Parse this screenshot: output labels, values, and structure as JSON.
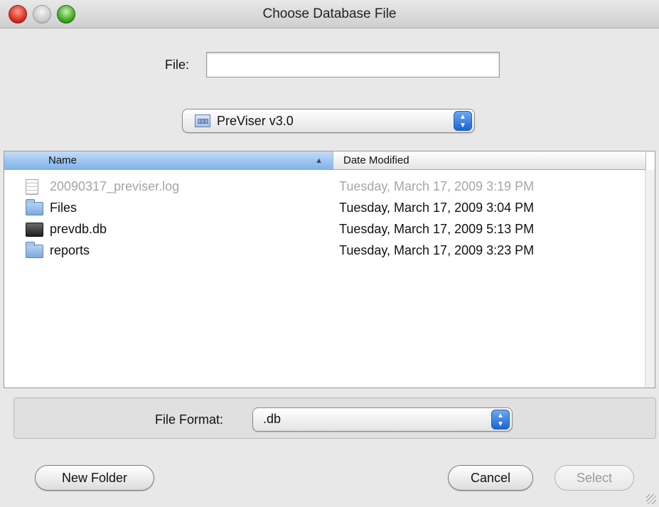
{
  "window": {
    "title": "Choose Database File"
  },
  "file": {
    "label": "File:",
    "value": "",
    "placeholder": ""
  },
  "location": {
    "selected": "PreViser v3.0",
    "icon": "folder-drive-icon"
  },
  "browser": {
    "columns": {
      "name": "Name",
      "date": "Date Modified",
      "sort": "ascending"
    },
    "rows": [
      {
        "name": "20090317_previser.log",
        "date": "Tuesday, March 17, 2009 3:19 PM",
        "icon": "document-icon",
        "enabled": false
      },
      {
        "name": "Files",
        "date": "Tuesday, March 17, 2009 3:04 PM",
        "icon": "folder-icon",
        "enabled": true
      },
      {
        "name": "prevdb.db",
        "date": "Tuesday, March 17, 2009 5:13 PM",
        "icon": "database-file-icon",
        "enabled": true
      },
      {
        "name": "reports",
        "date": "Tuesday, March 17, 2009 3:23 PM",
        "icon": "folder-icon",
        "enabled": true
      }
    ]
  },
  "format": {
    "label": "File Format:",
    "selected": ".db"
  },
  "buttons": {
    "new_folder": "New Folder",
    "cancel": "Cancel",
    "select": "Select"
  },
  "colors": {
    "accent": "#3b82d8",
    "header_selected": "#7fb2ea",
    "disabled_text": "#a6a6a6"
  }
}
